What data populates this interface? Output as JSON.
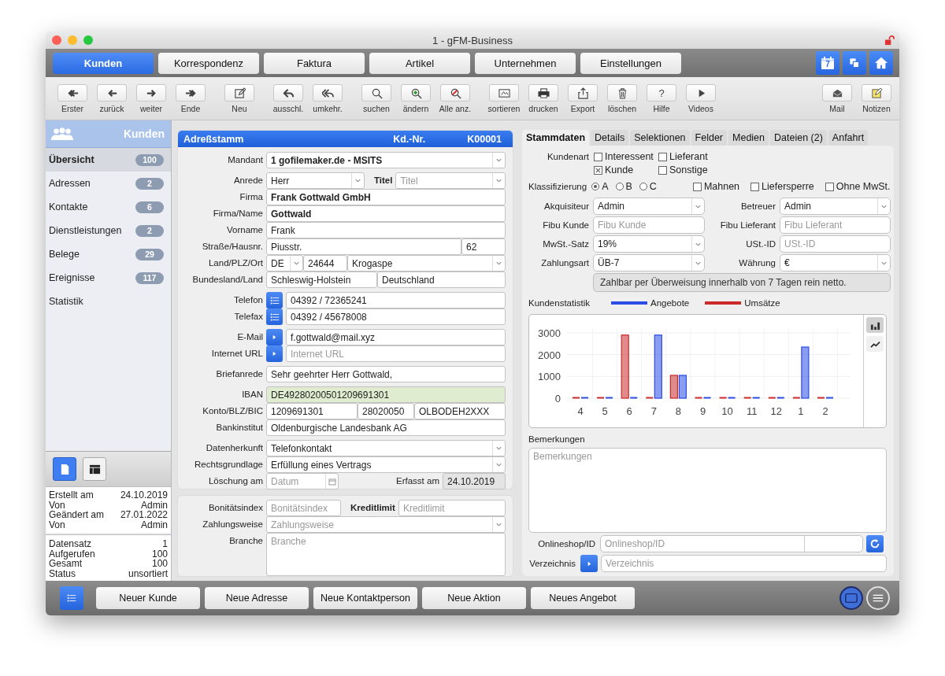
{
  "window": {
    "title": "1 - gFM-Business"
  },
  "nav_tabs": [
    {
      "label": "Kunden",
      "selected": true
    },
    {
      "label": "Korrespondenz",
      "selected": false
    },
    {
      "label": "Faktura",
      "selected": false
    },
    {
      "label": "Artikel",
      "selected": false
    },
    {
      "label": "Unternehmen",
      "selected": false
    },
    {
      "label": "Einstellungen",
      "selected": false
    }
  ],
  "calendar_day": "7",
  "toolbar": [
    {
      "label": "Erster"
    },
    {
      "label": "zurück"
    },
    {
      "label": "weiter"
    },
    {
      "label": "Ende"
    },
    {
      "label": "Neu"
    },
    {
      "label": "ausschl."
    },
    {
      "label": "umkehr."
    },
    {
      "label": "suchen"
    },
    {
      "label": "ändern"
    },
    {
      "label": "Alle anz."
    },
    {
      "label": "sortieren"
    },
    {
      "label": "drucken"
    },
    {
      "label": "Export"
    },
    {
      "label": "löschen"
    },
    {
      "label": "Hilfe",
      "glyph": "?"
    },
    {
      "label": "Videos"
    }
  ],
  "toolbar_right": [
    {
      "label": "Mail"
    },
    {
      "label": "Notizen"
    }
  ],
  "sidebar": {
    "title": "Kunden",
    "items": [
      {
        "label": "Übersicht",
        "count": "100",
        "selected": true
      },
      {
        "label": "Adressen",
        "count": "2",
        "selected": false
      },
      {
        "label": "Kontakte",
        "count": "6",
        "selected": false
      },
      {
        "label": "Dienstleistungen",
        "count": "2",
        "selected": false
      },
      {
        "label": "Belege",
        "count": "29",
        "selected": false
      },
      {
        "label": "Ereignisse",
        "count": "117",
        "selected": false
      },
      {
        "label": "Statistik",
        "selected": false
      }
    ],
    "views": [
      {
        "selected": true
      },
      {
        "selected": false
      }
    ],
    "record_info": [
      {
        "label": "Erstellt am",
        "value": "24.10.2019"
      },
      {
        "label": "Von",
        "value": "Admin"
      },
      {
        "label": "Geändert am",
        "value": "27.01.2022"
      },
      {
        "label": "Von",
        "value": "Admin"
      }
    ],
    "record_stats": [
      {
        "label": "Datensatz",
        "value": "1"
      },
      {
        "label": "Aufgerufen",
        "value": "100"
      },
      {
        "label": "Gesamt",
        "value": "100"
      },
      {
        "label": "Status",
        "value": "unsortiert"
      }
    ]
  },
  "address": {
    "title": "Adreßstamm",
    "number_label": "Kd.-Nr.",
    "number": "K00001",
    "mandant": {
      "label": "Mandant",
      "value": "1 gofilemaker.de - MSITS"
    },
    "anrede": {
      "label": "Anrede",
      "value": "Herr"
    },
    "titel": {
      "label": "Titel",
      "placeholder": "Titel"
    },
    "firma": {
      "label": "Firma",
      "value": "Frank Gottwald GmbH"
    },
    "name": {
      "label": "Firma/Name",
      "value": "Gottwald"
    },
    "vorname": {
      "label": "Vorname",
      "value": "Frank"
    },
    "strasse": {
      "label": "Straße/Hausnr.",
      "street": "Piusstr.",
      "number": "62"
    },
    "ort": {
      "label": "Land/PLZ/Ort",
      "country": "DE",
      "zip": "24644",
      "city": "Krogaspe"
    },
    "region": {
      "label": "Bundesland/Land",
      "state": "Schleswig-Holstein",
      "country": "Deutschland"
    },
    "telefon": {
      "label": "Telefon",
      "value": "04392 / 72365241"
    },
    "telefax": {
      "label": "Telefax",
      "value": "04392 / 45678008"
    },
    "email": {
      "label": "E-Mail",
      "value": "f.gottwald@mail.xyz"
    },
    "url": {
      "label": "Internet URL",
      "placeholder": "Internet URL"
    },
    "briefanrede": {
      "label": "Briefanrede",
      "value": "Sehr geehrter Herr Gottwald,"
    },
    "iban": {
      "label": "IBAN",
      "value": "DE49280200501209691301"
    },
    "konto": {
      "label": "Konto/BLZ/BIC",
      "account": "1209691301",
      "blz": "28020050",
      "bic": "OLBODEH2XXX"
    },
    "bank": {
      "label": "Bankinstitut",
      "value": "Oldenburgische Landesbank AG"
    },
    "herkunft": {
      "label": "Datenherkunft",
      "value": "Telefonkontakt"
    },
    "rechtsgrundlage": {
      "label": "Rechtsgrundlage",
      "value": "Erfüllung eines Vertrags"
    },
    "loeschung": {
      "label": "Löschung am",
      "placeholder": "Datum"
    },
    "erfasst": {
      "label": "Erfasst am",
      "value": "24.10.2019"
    }
  },
  "finance": {
    "bonitaet": {
      "label": "Bonitätsindex",
      "placeholder": "Bonitätsindex"
    },
    "kreditlimit": {
      "label": "Kreditlimit",
      "placeholder": "Kreditlimit"
    },
    "zahlungsweise": {
      "label": "Zahlungsweise",
      "placeholder": "Zahlungsweise"
    },
    "branche": {
      "label": "Branche",
      "placeholder": "Branche"
    }
  },
  "detail_tabs": [
    {
      "label": "Stammdaten",
      "selected": true
    },
    {
      "label": "Details",
      "selected": false
    },
    {
      "label": "Selektionen",
      "selected": false
    },
    {
      "label": "Felder",
      "selected": false
    },
    {
      "label": "Medien",
      "selected": false
    },
    {
      "label": "Dateien (2)",
      "selected": false
    },
    {
      "label": "Anfahrt",
      "selected": false
    }
  ],
  "kundenart": {
    "label": "Kundenart",
    "options": [
      {
        "label": "Interessent",
        "checked": false
      },
      {
        "label": "Lieferant",
        "checked": false
      },
      {
        "label": "Kunde",
        "checked": true
      },
      {
        "label": "Sonstige",
        "checked": false
      }
    ]
  },
  "klassifizierung": {
    "label": "Klassifizierung",
    "options": [
      {
        "label": "A",
        "selected": true
      },
      {
        "label": "B",
        "selected": false
      },
      {
        "label": "C",
        "selected": false
      }
    ]
  },
  "flags": [
    {
      "label": "Mahnen",
      "checked": false
    },
    {
      "label": "Liefersperre",
      "checked": false
    },
    {
      "label": "Ohne MwSt.",
      "checked": false
    }
  ],
  "akquisiteur": {
    "label": "Akquisiteur",
    "value": "Admin"
  },
  "betreuer": {
    "label": "Betreuer",
    "value": "Admin"
  },
  "fibu_kunde": {
    "label": "Fibu Kunde",
    "placeholder": "Fibu Kunde"
  },
  "fibu_lieferant": {
    "label": "Fibu Lieferant",
    "placeholder": "Fibu Lieferant"
  },
  "mwst": {
    "label": "MwSt.-Satz",
    "value": "19%"
  },
  "ustid": {
    "label": "USt.-ID",
    "placeholder": "USt.-ID"
  },
  "zahlungsart": {
    "label": "Zahlungsart",
    "value": "ÜB-7"
  },
  "waehrung": {
    "label": "Währung",
    "value": "€"
  },
  "zahlungstext": "Zahlbar per Überweisung innerhalb von 7 Tagen rein netto.",
  "statistics": {
    "chart_modes": [
      {
        "selected": true
      },
      {
        "selected": false
      }
    ],
    "chart_data": {
      "type": "bar",
      "title": "Kundenstatistik",
      "categories": [
        "4",
        "5",
        "6",
        "7",
        "8",
        "9",
        "10",
        "11",
        "12",
        "1",
        "2"
      ],
      "series": [
        {
          "name": "Angebote",
          "color": "#2b4de6",
          "values": [
            0,
            0,
            0,
            2900,
            1050,
            0,
            0,
            0,
            0,
            2350,
            0
          ]
        },
        {
          "name": "Umsätze",
          "color": "#cc2a2a",
          "values": [
            0,
            0,
            2900,
            0,
            1050,
            0,
            0,
            0,
            0,
            0,
            0
          ]
        }
      ],
      "ylim": [
        0,
        3000
      ],
      "yticks": [
        0,
        1000,
        2000,
        3000
      ]
    }
  },
  "bemerkungen": {
    "label": "Bemerkungen",
    "placeholder": "Bemerkungen"
  },
  "onlineshop": {
    "label": "Onlineshop/ID",
    "placeholder": "Onlineshop/ID"
  },
  "verzeichnis": {
    "label": "Verzeichnis",
    "placeholder": "Verzeichnis"
  },
  "bottom_buttons": [
    "Neuer Kunde",
    "Neue Adresse",
    "Neue Kontaktperson",
    "Neue Aktion",
    "Neues Angebot"
  ],
  "layout_modes": [
    {
      "selected": true
    },
    {
      "selected": false
    }
  ]
}
